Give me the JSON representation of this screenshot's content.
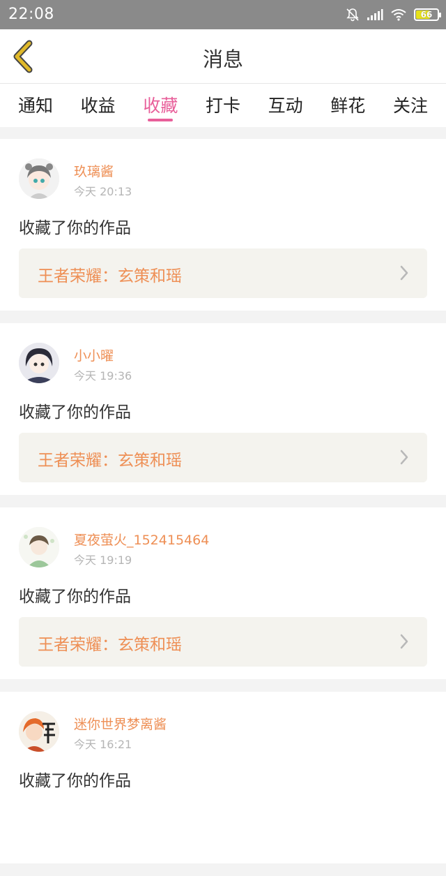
{
  "status_bar": {
    "time": "22:08",
    "battery": "66"
  },
  "header": {
    "title": "消息"
  },
  "tabs": [
    {
      "label": "通知"
    },
    {
      "label": "收益"
    },
    {
      "label": "收藏",
      "active": true
    },
    {
      "label": "打卡"
    },
    {
      "label": "互动"
    },
    {
      "label": "鲜花"
    },
    {
      "label": "关注"
    }
  ],
  "messages": [
    {
      "username": "玖璃酱",
      "time": "今天 20:13",
      "action": "收藏了你的作品",
      "work_title": "王者荣耀：玄策和瑶"
    },
    {
      "username": "小小曜",
      "time": "今天 19:36",
      "action": "收藏了你的作品",
      "work_title": "王者荣耀：玄策和瑶"
    },
    {
      "username": "夏夜萤火_152415464",
      "time": "今天 19:19",
      "action": "收藏了你的作品",
      "work_title": "王者荣耀：玄策和瑶"
    },
    {
      "username": "迷你世界梦离酱",
      "time": "今天 16:21",
      "action": "收藏了你的作品",
      "work_title": ""
    }
  ],
  "colors": {
    "accent": "#e85f9a",
    "username": "#ee8f55",
    "status_bar": "#8a8a8a",
    "back_icon": "#d9b020"
  }
}
